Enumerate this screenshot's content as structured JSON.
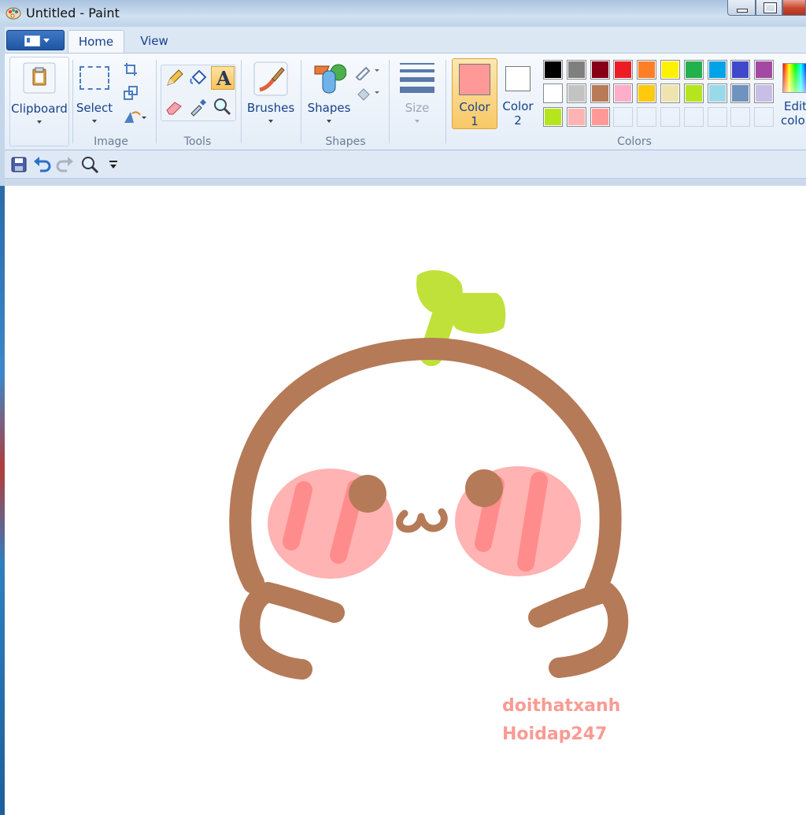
{
  "window": {
    "title": "Untitled - Paint"
  },
  "tabs": [
    {
      "label": "Home"
    },
    {
      "label": "View"
    }
  ],
  "ribbon": {
    "clipboard": {
      "label": "Clipboard"
    },
    "image": {
      "select_label": "Select",
      "group_label": "Image"
    },
    "tools": {
      "group_label": "Tools"
    },
    "brushes": {
      "label": "Brushes"
    },
    "shapes": {
      "label": "Shapes",
      "group_label": "Shapes"
    },
    "size": {
      "label": "Size"
    },
    "color1": {
      "label_line1": "Color",
      "label_line2": "1",
      "value": "#ff9998"
    },
    "color2": {
      "label_line1": "Color",
      "label_line2": "2",
      "value": "#ffffff"
    },
    "colors": {
      "group_label": "Colors",
      "palette_rows": [
        [
          "#000000",
          "#7f7f7f",
          "#880015",
          "#ed1c24",
          "#ff7f27",
          "#fff200",
          "#22b14c",
          "#00a2e8",
          "#3f48cc",
          "#a349a4"
        ],
        [
          "#ffffff",
          "#c3c3c3",
          "#b97a57",
          "#ffaec9",
          "#ffc90e",
          "#efe4b0",
          "#b5e61d",
          "#99d9ea",
          "#7092be",
          "#c8bfe7"
        ],
        [
          "#b5e61d",
          "#ffb3b3",
          "#ff9998",
          "",
          "",
          "",
          "",
          "",
          "",
          ""
        ]
      ]
    },
    "edit_colors": {
      "label_line1": "Edit",
      "label_line2": "colo"
    }
  },
  "quick_access": {
    "icons": [
      "save-icon",
      "undo-icon",
      "redo-icon",
      "zoom-icon",
      "customize-icon"
    ]
  },
  "canvas": {
    "watermark_line1": "doithatxanh",
    "watermark_line2": "Hoidap247",
    "drawing_colors": {
      "outline": "#b57a57",
      "sprout": "#bfe13a",
      "cheek": "#ffb3b3",
      "cheek_stripe": "#ff8c8c",
      "watermark": "#f99b94"
    }
  }
}
